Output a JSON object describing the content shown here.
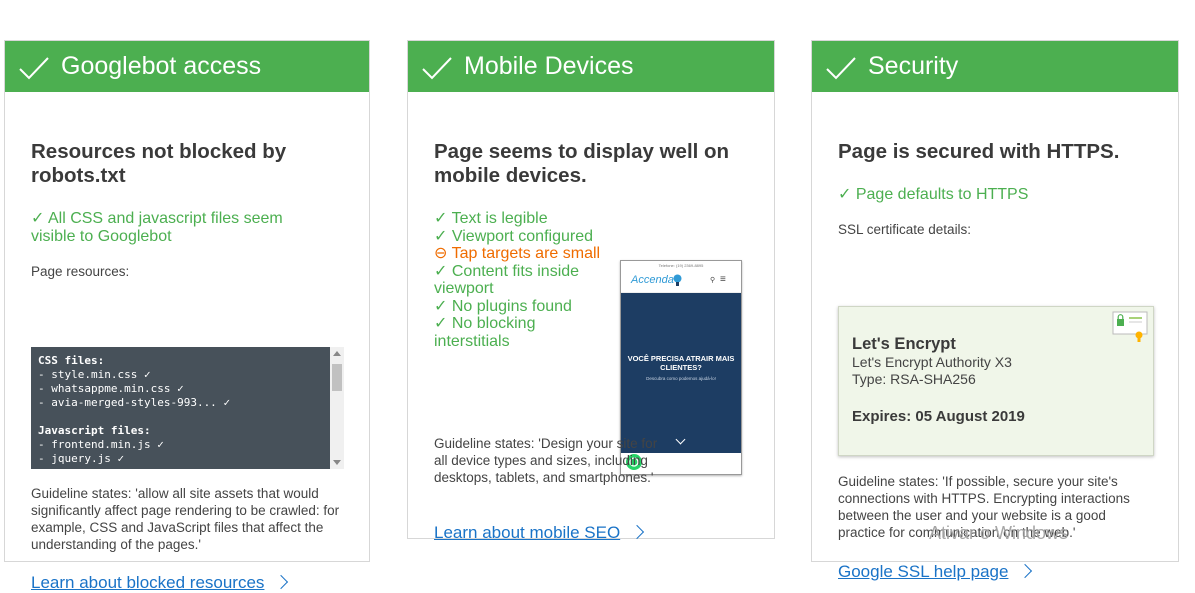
{
  "colors": {
    "header_green": "#4caf50",
    "link_blue": "#1a73c7",
    "warning_orange": "#ef6c00",
    "code_bg": "#47515a"
  },
  "cards": {
    "googlebot": {
      "header": "Googlebot access",
      "heading": "Resources not blocked by robots.txt",
      "status": "All CSS and javascript files seem visible to Googlebot",
      "resources_label": "Page resources:",
      "code": {
        "css_heading": "CSS files:",
        "css_files": [
          "- style.min.css",
          "- whatsappme.min.css",
          "- avia-merged-styles-993..."
        ],
        "js_heading": "Javascript files:",
        "js_files": [
          "- frontend.min.js",
          "- jquery.js"
        ]
      },
      "guideline": "Guideline states: 'allow all site assets that would significantly affect page rendering to be crawled: for example, CSS and JavaScript files that affect the understanding of the pages.'",
      "link": "Learn about blocked resources"
    },
    "mobile": {
      "header": "Mobile Devices",
      "heading": "Page seems to display well on mobile devices.",
      "checks": [
        {
          "label": "Text is legible",
          "status": "ok"
        },
        {
          "label": "Viewport configured",
          "status": "ok"
        },
        {
          "label": "Tap targets are small",
          "status": "warning"
        },
        {
          "label": "Content fits inside viewport",
          "status": "ok"
        },
        {
          "label": "No plugins found",
          "status": "ok"
        },
        {
          "label": "No blocking interstitials",
          "status": "ok"
        }
      ],
      "phone": {
        "top_bar": "Telefone: (19) 2369-8895",
        "logo": "Accenda",
        "hero_title": "VOCÊ PRECISA ATRAIR MAIS CLIENTES?",
        "hero_sub": "Descubra como podemos ajudá-lo!"
      },
      "guideline": "Guideline states: 'Design your site for all device types and sizes, including desktops, tablets, and smartphones.'",
      "link": "Learn about mobile SEO"
    },
    "security": {
      "header": "Security",
      "heading": "Page is secured with HTTPS.",
      "status": "Page defaults to HTTPS",
      "ssl_label": "SSL certificate details:",
      "cert": {
        "issuer": "Let's Encrypt",
        "authority": "Let's Encrypt Authority X3",
        "type": "Type: RSA-SHA256",
        "expires": "Expires: 05 August 2019"
      },
      "guideline": "Guideline states: 'If possible, secure your site's connections with HTTPS. Encrypting interactions between the user and your website is a good practice for communication on the web.'",
      "link": "Google SSL help page"
    }
  },
  "watermark": "Ativar o Windows"
}
